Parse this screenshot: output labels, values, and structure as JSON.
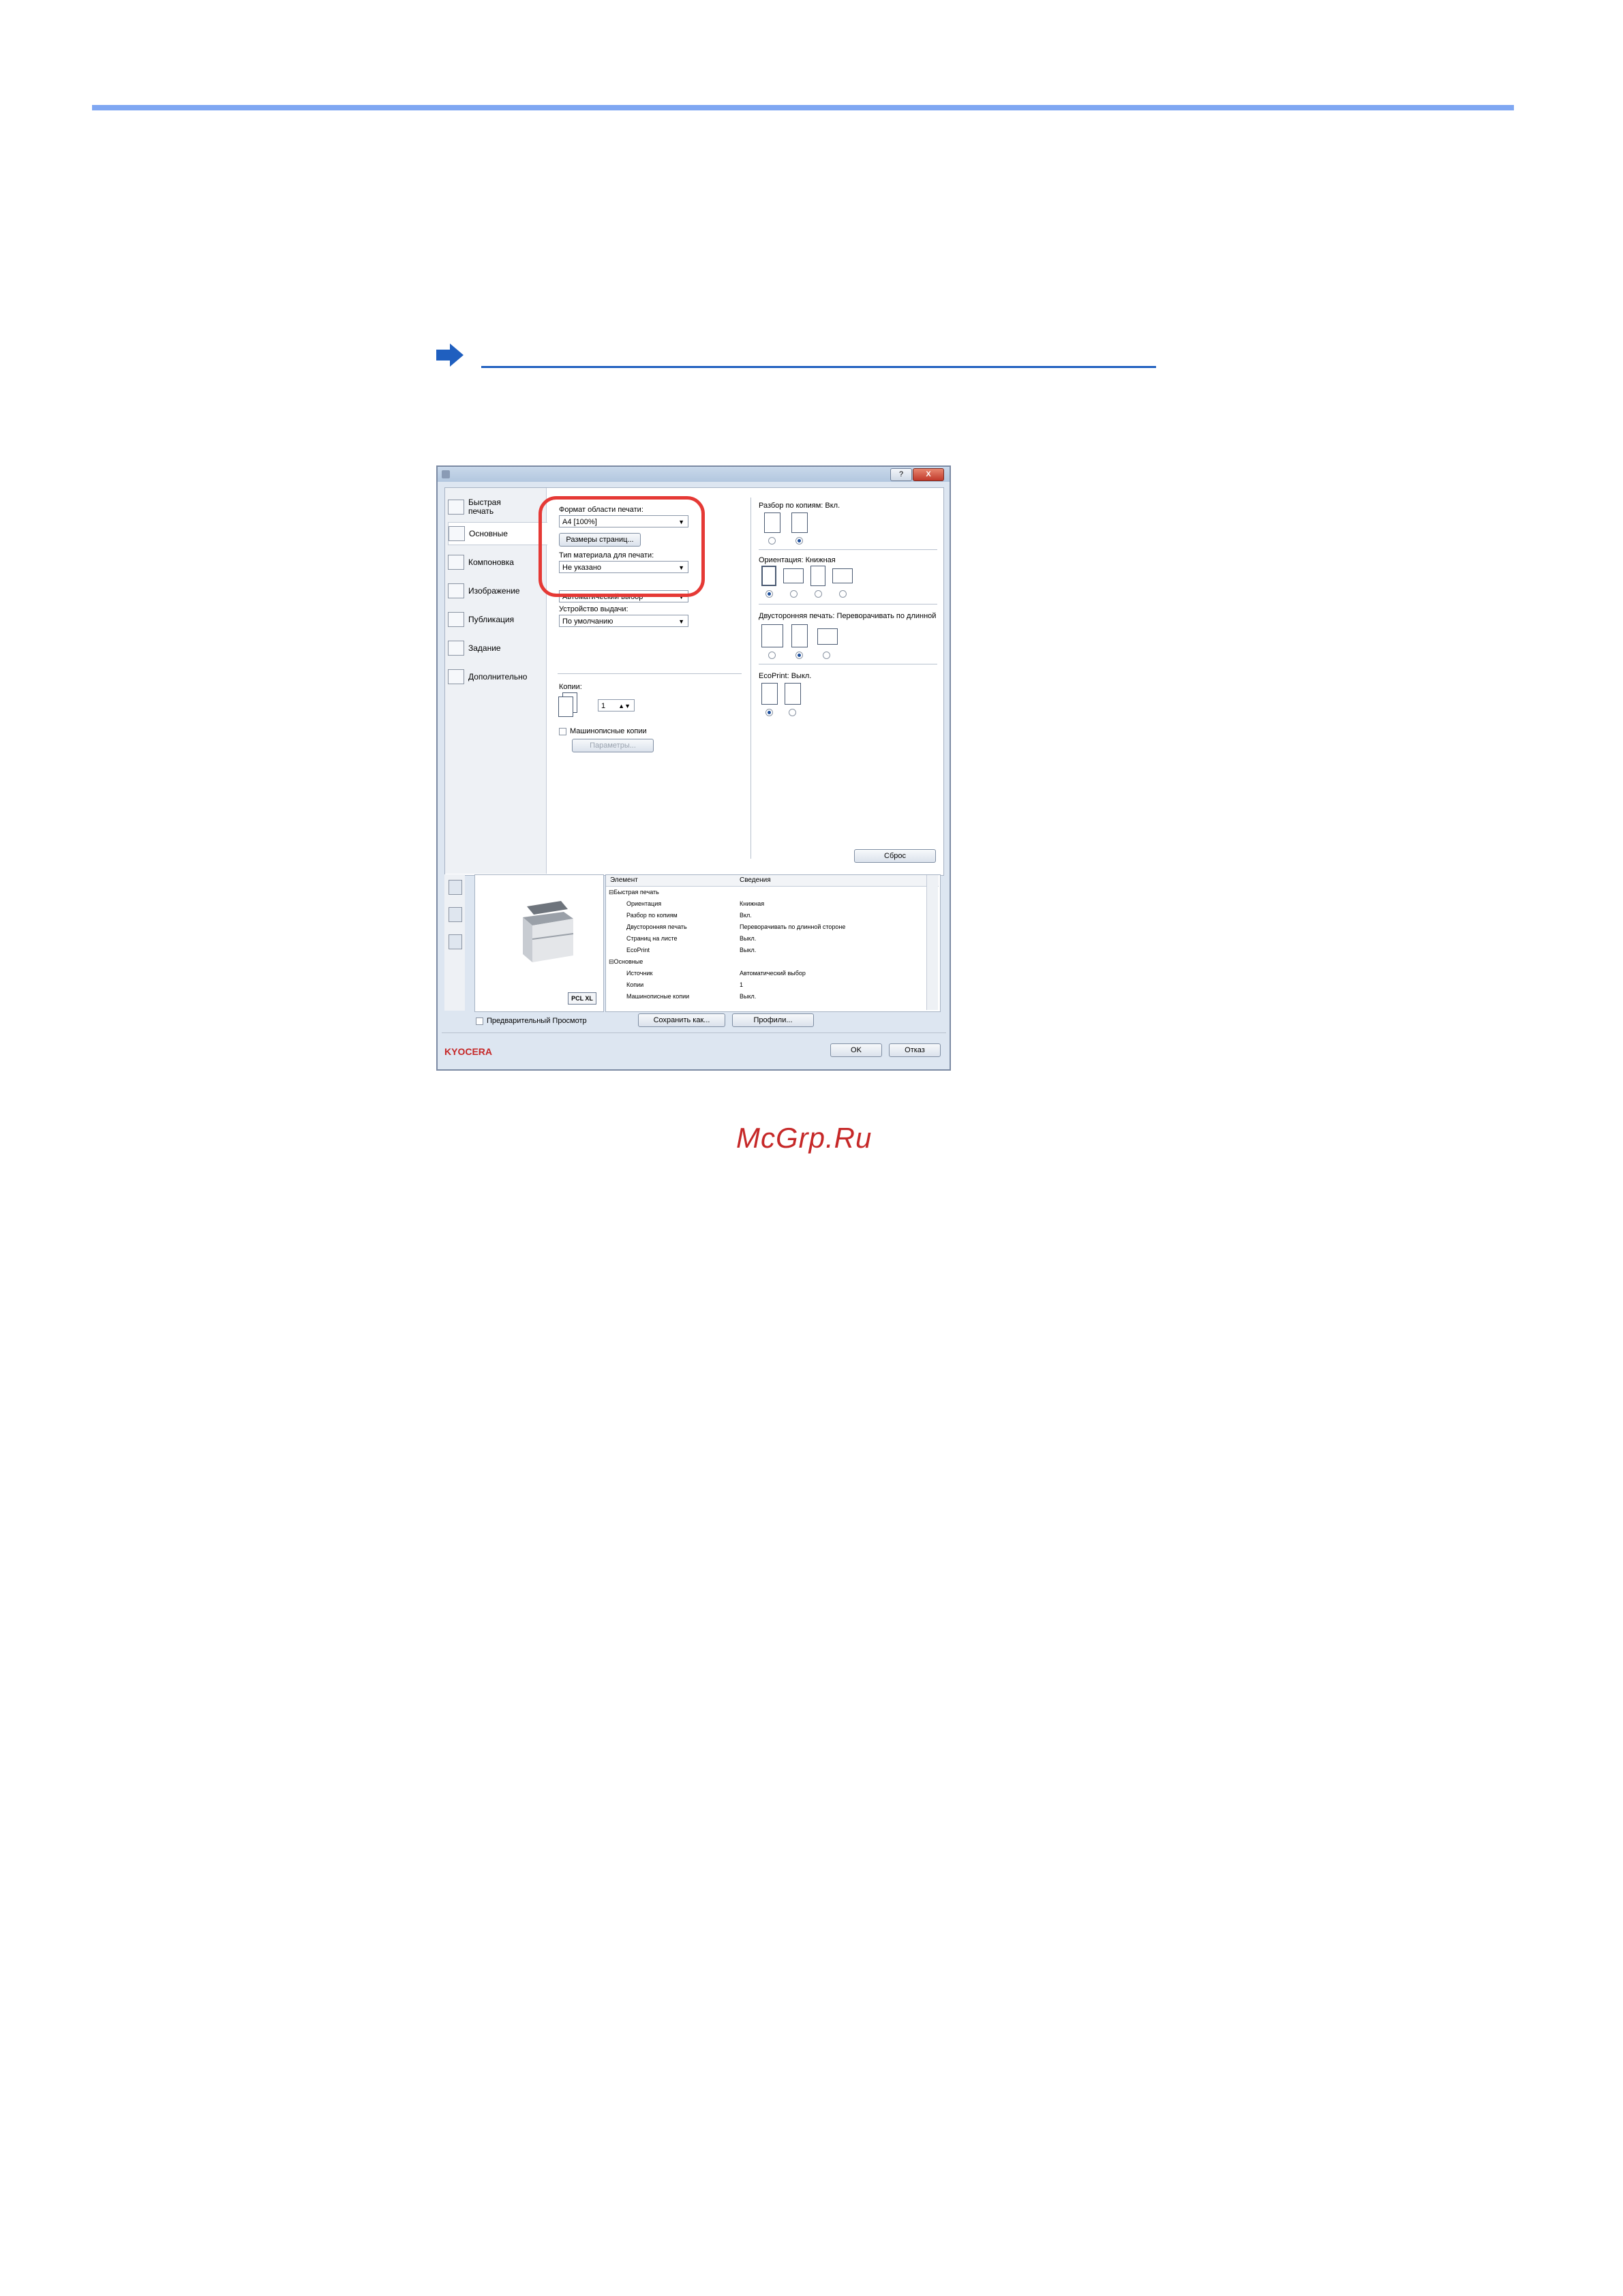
{
  "dialog": {
    "tabs": [
      {
        "label": "Быстрая печать",
        "icon": "quick-print-icon"
      },
      {
        "label": "Основные",
        "icon": "basic-icon"
      },
      {
        "label": "Компоновка",
        "icon": "layout-icon"
      },
      {
        "label": "Изображение",
        "icon": "image-icon"
      },
      {
        "label": "Публикация",
        "icon": "publishing-icon"
      },
      {
        "label": "Задание",
        "icon": "job-icon"
      },
      {
        "label": "Дополнительно",
        "icon": "advanced-icon"
      }
    ],
    "print_area_label": "Формат области печати:",
    "print_area_value": "A4 [100%]",
    "page_sizes_button": "Размеры страниц...",
    "media_type_label": "Тип материала для печати:",
    "media_type_value": "Не указано",
    "source_value": "Автоматический выбор",
    "output_label": "Устройство выдачи:",
    "output_value": "По умолчанию",
    "copies_label": "Копии:",
    "copies_value": "1",
    "collated_label": "Машинописные копии",
    "params_button": "Параметры...",
    "collate_label": "Разбор по копиям:",
    "collate_value": "Вкл.",
    "orientation_label": "Ориентация:",
    "orientation_value": "Книжная",
    "duplex_label": "Двусторонняя печать:",
    "duplex_value": "Переворачивать по длинной",
    "ecoprint_label": "EcoPrint:",
    "ecoprint_value": "Выкл.",
    "reset_button": "Сброс",
    "preview_checkbox": "Предварительный Просмотр",
    "save_as_button": "Сохранить как...",
    "profiles_button": "Профили...",
    "ok_button": "OK",
    "cancel_button": "Отказ",
    "pdl_badge": "PCL XL",
    "brand": "KYOCERA",
    "help_glyph": "?",
    "close_glyph": "X",
    "table": {
      "header": [
        "Элемент",
        "Сведения"
      ],
      "rows": [
        {
          "item": "⊟Быстрая печать",
          "value": ""
        },
        {
          "item": "Ориентация",
          "value": "Книжная"
        },
        {
          "item": "Разбор по копиям",
          "value": "Вкл."
        },
        {
          "item": "Двусторонняя печать",
          "value": "Переворачивать по длинной стороне"
        },
        {
          "item": "Страниц на листе",
          "value": "Выкл."
        },
        {
          "item": "EcoPrint",
          "value": "Выкл."
        },
        {
          "item": "⊟Основные",
          "value": ""
        },
        {
          "item": "Источник",
          "value": "Автоматический выбор"
        },
        {
          "item": "Копии",
          "value": "1"
        },
        {
          "item": "Машинописные копии",
          "value": "Выкл."
        }
      ]
    }
  },
  "watermark": "McGrp.Ru",
  "colors": {
    "accent_rule": "#7fa7f2",
    "highlight": "#e53935",
    "link": "#1f5fbf"
  }
}
